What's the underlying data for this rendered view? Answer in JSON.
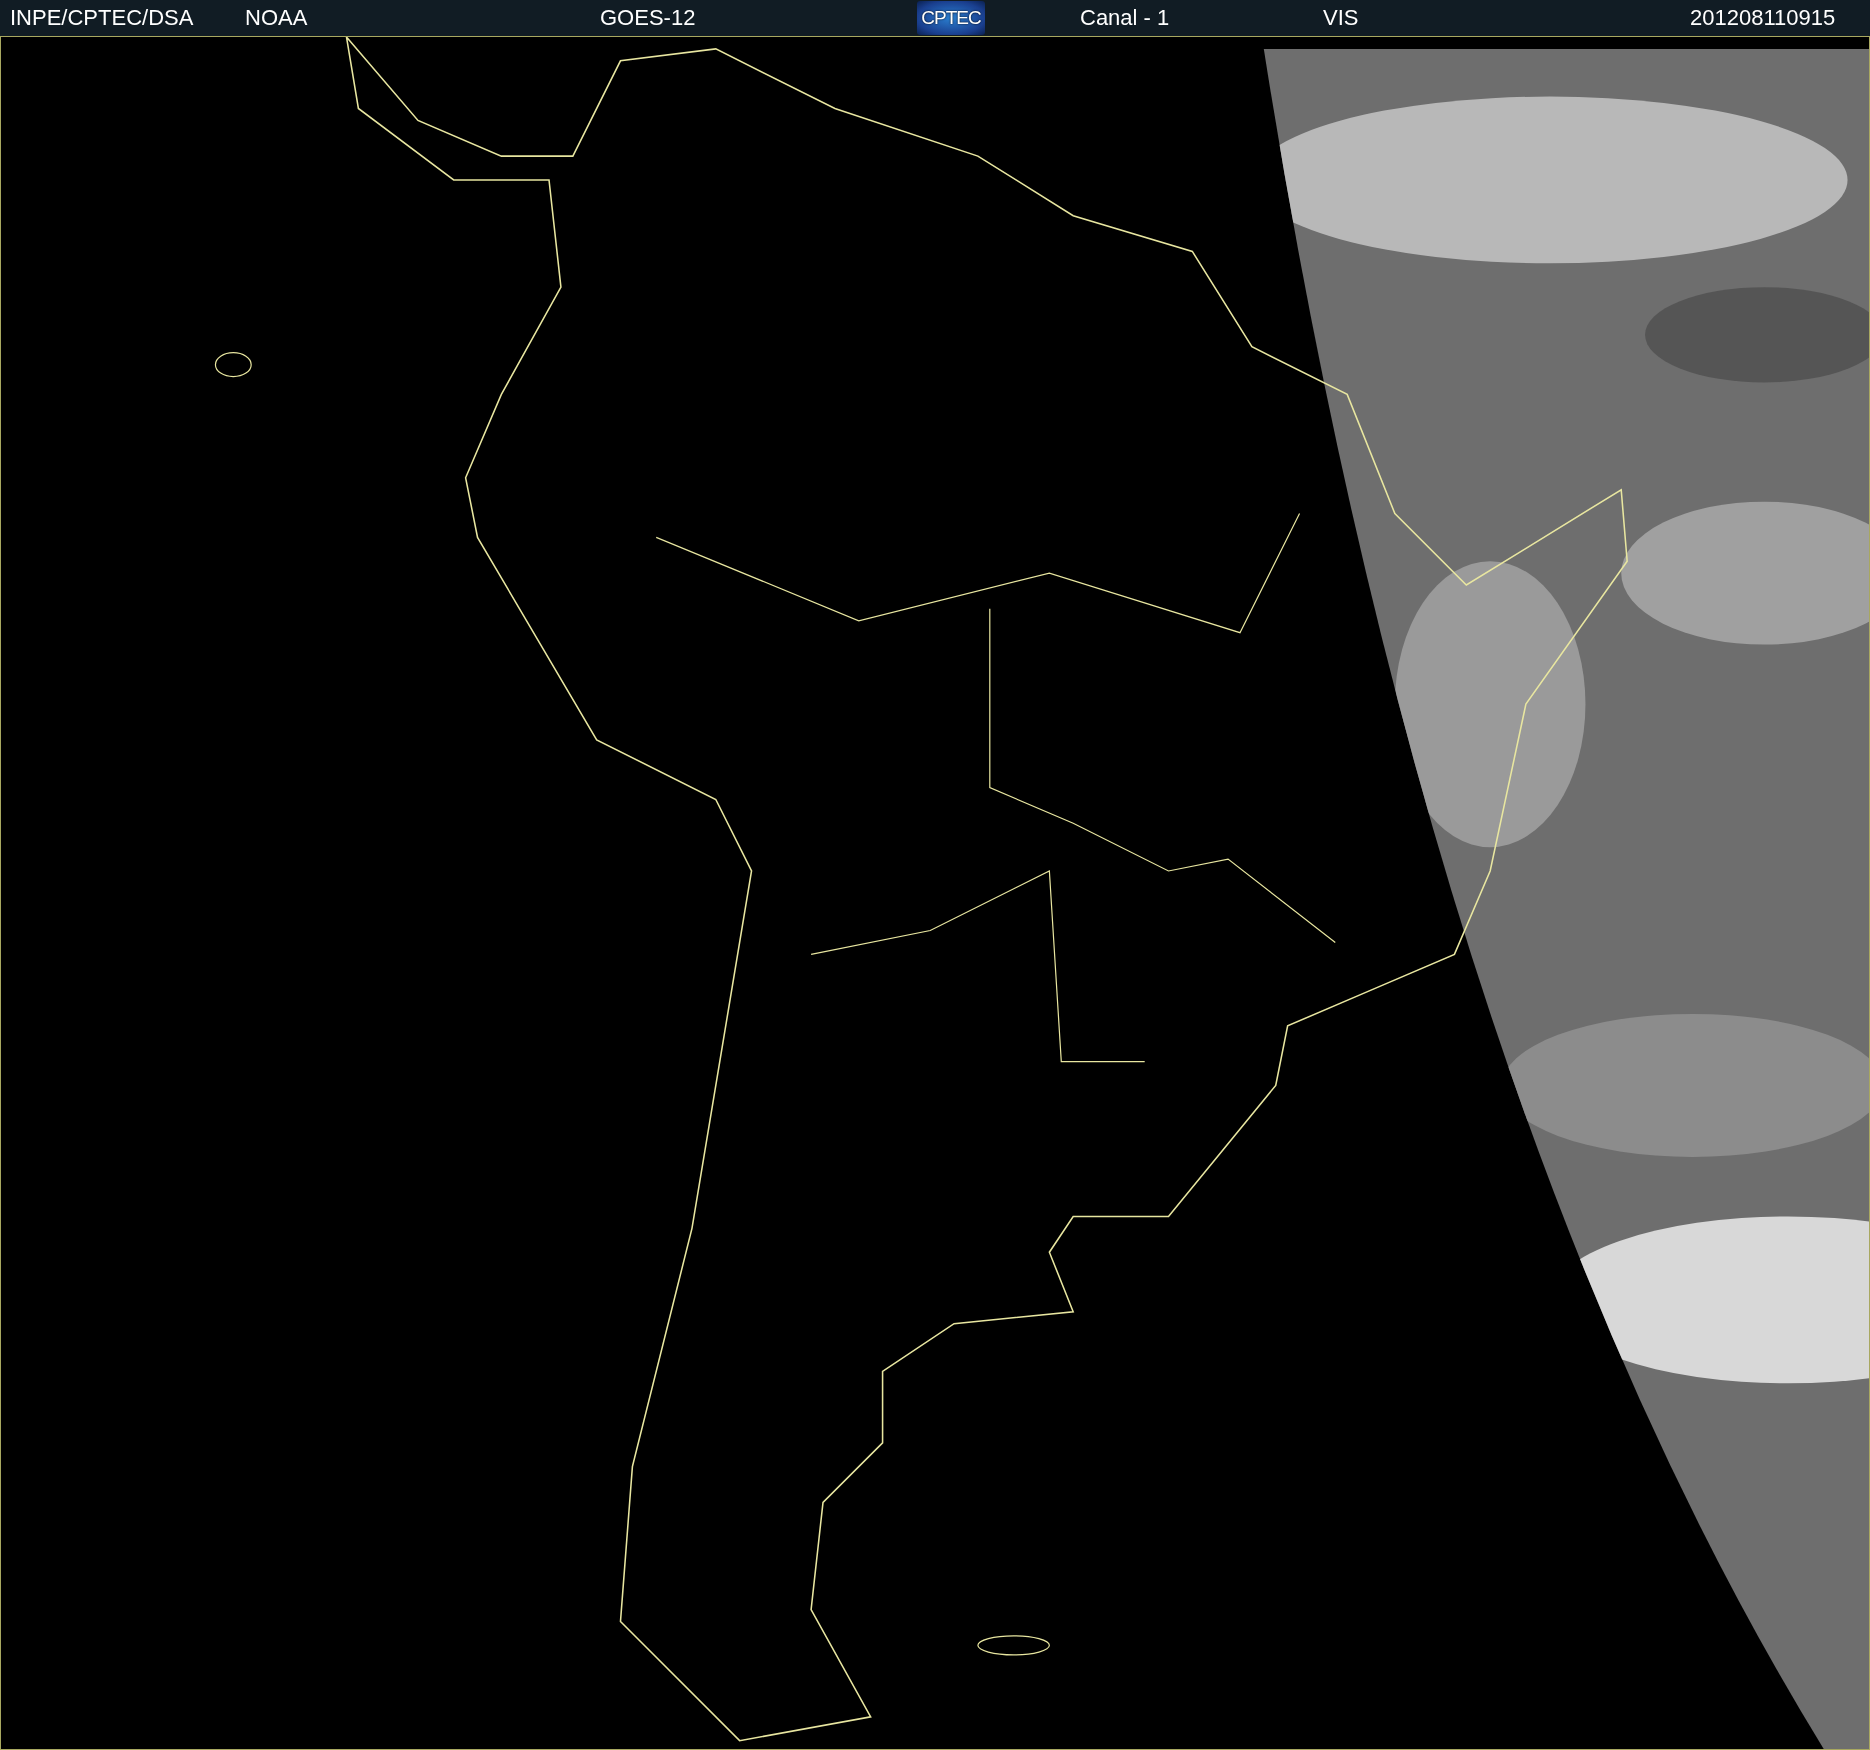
{
  "header": {
    "source": "INPE/CPTEC/DSA",
    "agency": "NOAA",
    "satellite": "GOES-12",
    "logo": "CPTEC",
    "channel": "Canal - 1",
    "band": "VIS",
    "timestamp": "201208110915"
  }
}
